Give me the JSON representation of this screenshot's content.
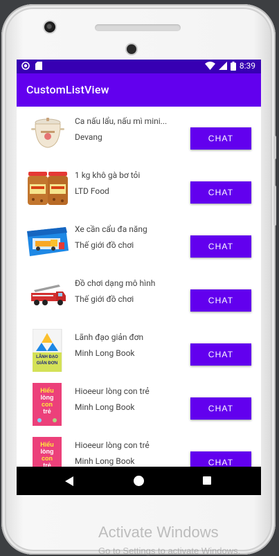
{
  "status_bar": {
    "time": "8:39"
  },
  "app_bar": {
    "title": "CustomListView"
  },
  "items": [
    {
      "title": "Ca nấu lẩu, nấu mì mini...",
      "seller": "Devang",
      "button": "CHAT"
    },
    {
      "title": "1 kg khô gà bơ tỏi",
      "seller": "LTD Food",
      "button": "CHAT"
    },
    {
      "title": "Xe cần cẩu đa năng",
      "seller": "Thế giới đồ chơi",
      "button": "CHAT"
    },
    {
      "title": "Đồ chơi dạng mô hình",
      "seller": "Thế giới đồ chơi",
      "button": "CHAT"
    },
    {
      "title": "Lãnh đạo giản đơn",
      "seller": "Minh Long Book",
      "button": "CHAT"
    },
    {
      "title": "Hioeeur lòng con trẻ",
      "seller": "Minh Long Book",
      "button": "CHAT"
    },
    {
      "title": "Hioeeur lòng con trẻ",
      "seller": "Minh Long Book",
      "button": "CHAT"
    }
  ],
  "book_covers": {
    "leadership": [
      "LÃNH ĐẠO",
      "GIẢN ĐƠN"
    ],
    "child": [
      "Hiểu",
      "lòng",
      "con",
      "trẻ"
    ]
  },
  "watermark": {
    "title": "Activate Windows",
    "subtitle": "Go to Settings to activate Windows."
  },
  "colors": {
    "primary": "#6200ee",
    "primary_dark": "#3700b3"
  }
}
